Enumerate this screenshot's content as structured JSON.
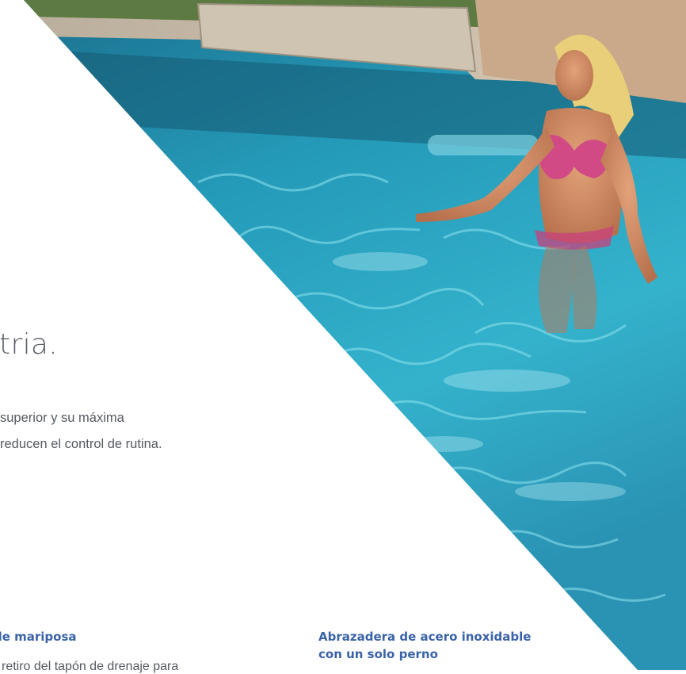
{
  "section": {
    "headline": "stria.",
    "body_lines": [
      "superior y su máxima",
      "reducen el control de rutina."
    ]
  },
  "features": {
    "left": {
      "title": "de mariposa",
      "text": "l retiro del tapón de drenaje para"
    },
    "right": {
      "title_lines": [
        "Abrazadera de acero inoxidable",
        "con un solo perno"
      ]
    }
  },
  "colors": {
    "heading_gray": "#5a5f66",
    "body_gray": "#555a61",
    "feature_blue": "#3a63a8",
    "pool_water": "#2fa3c0"
  }
}
